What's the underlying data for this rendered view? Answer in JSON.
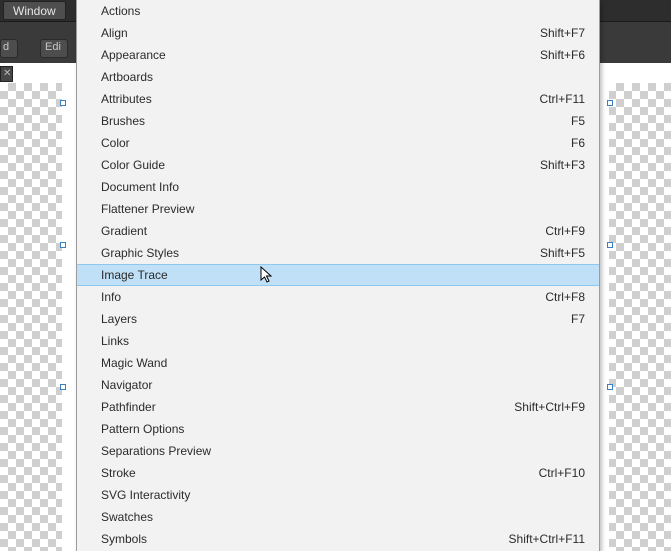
{
  "menubar": {
    "window_label": "Window"
  },
  "toolbar_fragments": {
    "frag1": "d",
    "frag2": "Edi"
  },
  "menu": {
    "highlighted_index": 12,
    "items": [
      {
        "label": "Actions",
        "shortcut": ""
      },
      {
        "label": "Align",
        "shortcut": "Shift+F7"
      },
      {
        "label": "Appearance",
        "shortcut": "Shift+F6"
      },
      {
        "label": "Artboards",
        "shortcut": ""
      },
      {
        "label": "Attributes",
        "shortcut": "Ctrl+F11"
      },
      {
        "label": "Brushes",
        "shortcut": "F5"
      },
      {
        "label": "Color",
        "shortcut": "F6"
      },
      {
        "label": "Color Guide",
        "shortcut": "Shift+F3"
      },
      {
        "label": "Document Info",
        "shortcut": ""
      },
      {
        "label": "Flattener Preview",
        "shortcut": ""
      },
      {
        "label": "Gradient",
        "shortcut": "Ctrl+F9"
      },
      {
        "label": "Graphic Styles",
        "shortcut": "Shift+F5"
      },
      {
        "label": "Image Trace",
        "shortcut": ""
      },
      {
        "label": "Info",
        "shortcut": "Ctrl+F8"
      },
      {
        "label": "Layers",
        "shortcut": "F7"
      },
      {
        "label": "Links",
        "shortcut": ""
      },
      {
        "label": "Magic Wand",
        "shortcut": ""
      },
      {
        "label": "Navigator",
        "shortcut": ""
      },
      {
        "label": "Pathfinder",
        "shortcut": "Shift+Ctrl+F9"
      },
      {
        "label": "Pattern Options",
        "shortcut": ""
      },
      {
        "label": "Separations Preview",
        "shortcut": ""
      },
      {
        "label": "Stroke",
        "shortcut": "Ctrl+F10"
      },
      {
        "label": "SVG Interactivity",
        "shortcut": ""
      },
      {
        "label": "Swatches",
        "shortcut": ""
      },
      {
        "label": "Symbols",
        "shortcut": "Shift+Ctrl+F11"
      }
    ]
  }
}
